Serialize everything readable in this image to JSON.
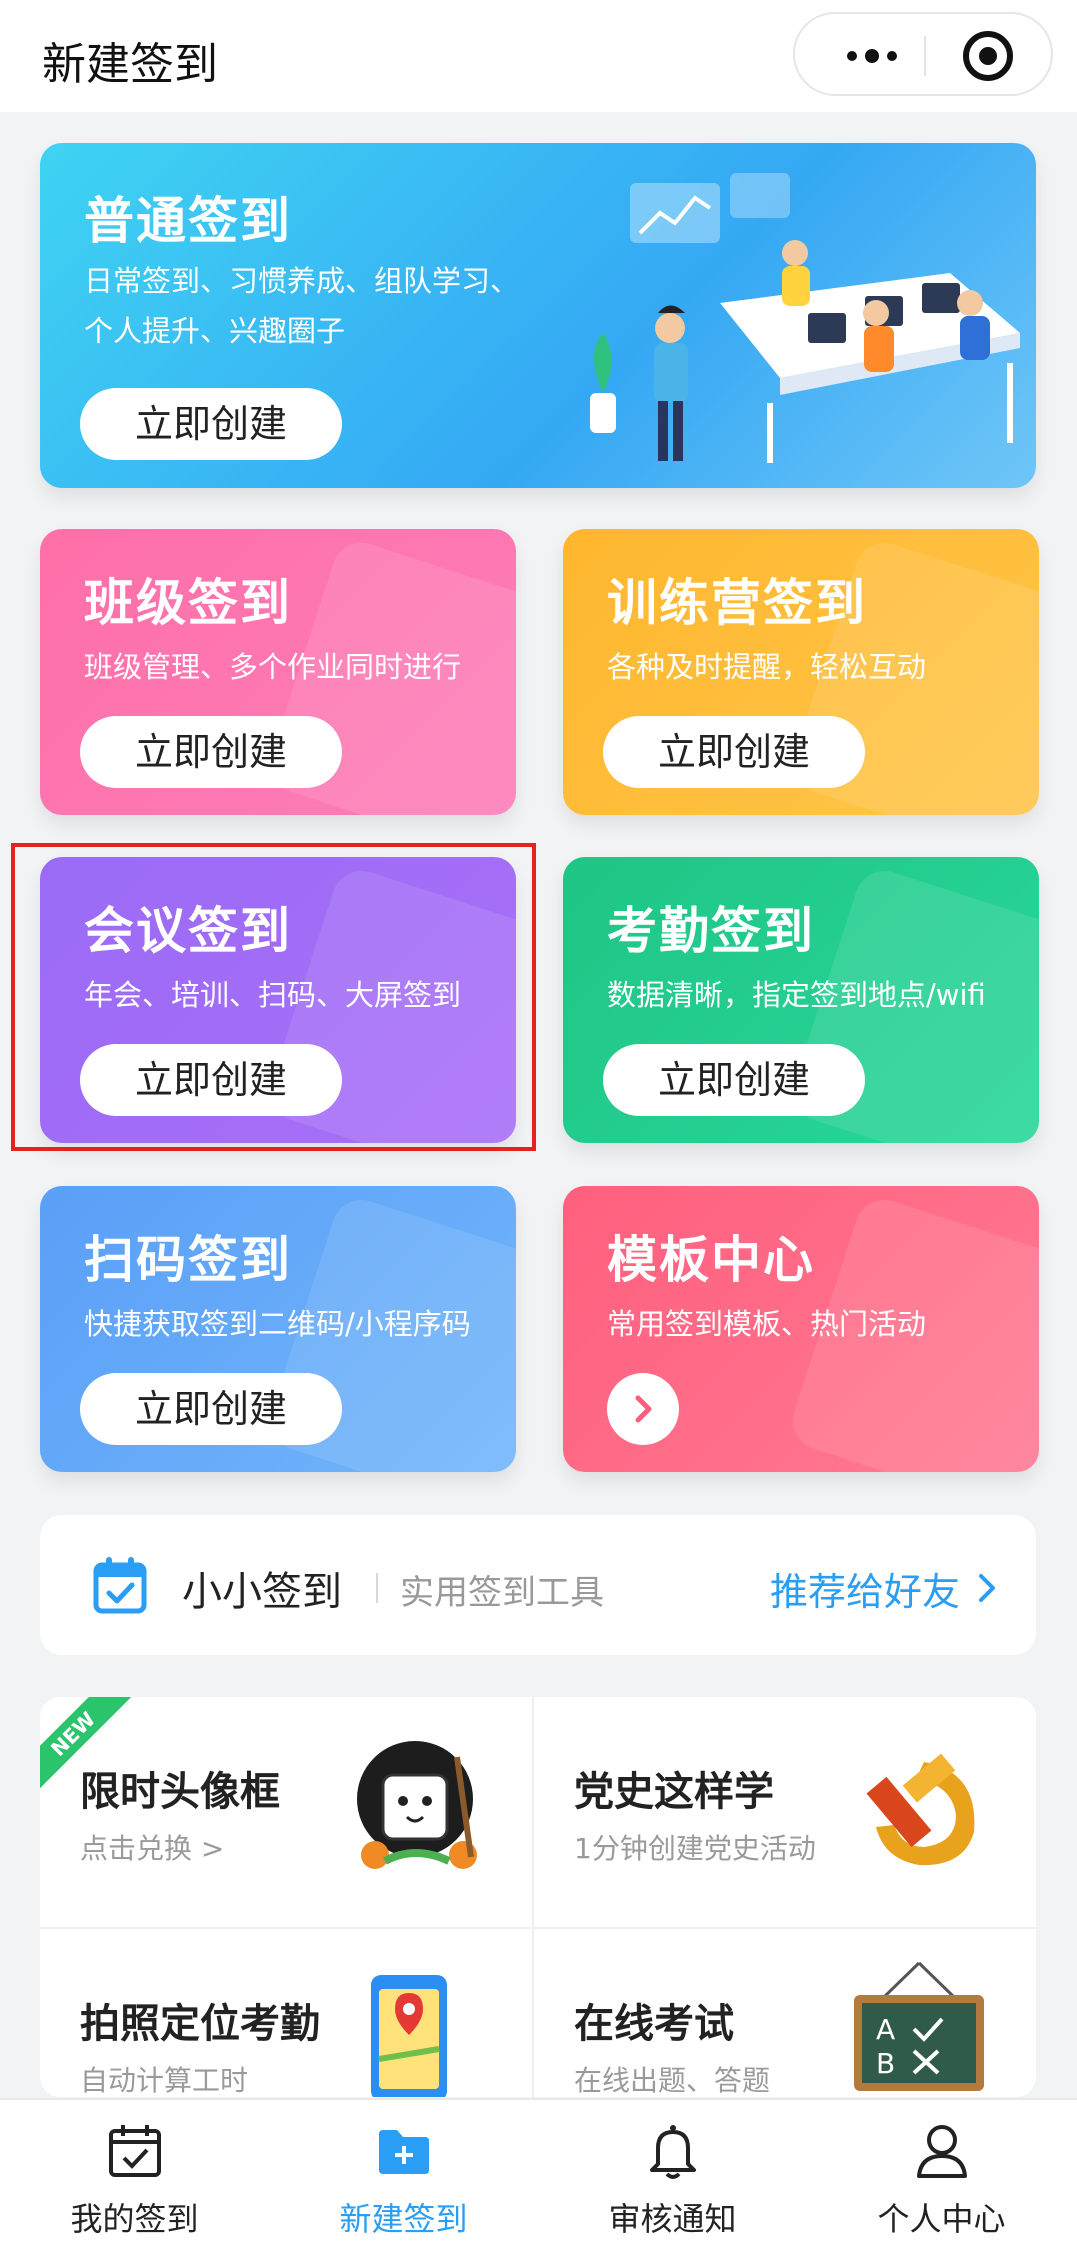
{
  "header": {
    "title": "新建签到"
  },
  "cards": {
    "normal": {
      "title": "普通签到",
      "desc_line1": "日常签到、习惯养成、组队学习、",
      "desc_line2": "个人提升、兴趣圈子",
      "button": "立即创建"
    },
    "class": {
      "title": "班级签到",
      "desc": "班级管理、多个作业同时进行",
      "button": "立即创建"
    },
    "camp": {
      "title": "训练营签到",
      "desc": "各种及时提醒，轻松互动",
      "button": "立即创建"
    },
    "meeting": {
      "title": "会议签到",
      "desc": "年会、培训、扫码、大屏签到",
      "button": "立即创建"
    },
    "attendance": {
      "title": "考勤签到",
      "desc": "数据清晰，指定签到地点/wifi",
      "button": "立即创建"
    },
    "scan": {
      "title": "扫码签到",
      "desc": "快捷获取签到二维码/小程序码",
      "button": "立即创建"
    },
    "template": {
      "title": "模板中心",
      "desc": "常用签到模板、热门活动"
    }
  },
  "brand": {
    "name": "小小签到",
    "slogan": "实用签到工具",
    "share": "推荐给好友"
  },
  "features": [
    {
      "title": "限时头像框",
      "sub": "点击兑换 >",
      "badge": "NEW"
    },
    {
      "title": "党史这样学",
      "sub": "1分钟创建党史活动"
    },
    {
      "title": "拍照定位考勤",
      "sub": "自动计算工时"
    },
    {
      "title": "在线考试",
      "sub": "在线出题、答题"
    }
  ],
  "tabs": [
    {
      "label": "我的签到",
      "icon": "calendar-check-icon"
    },
    {
      "label": "新建签到",
      "icon": "folder-plus-icon",
      "active": true
    },
    {
      "label": "审核通知",
      "icon": "bell-icon"
    },
    {
      "label": "个人中心",
      "icon": "person-icon"
    }
  ],
  "colors": {
    "accent": "#2a9df4",
    "normal": "#35a8f4",
    "class": "#ff6fa8",
    "camp": "#ffb62e",
    "meeting": "#9b6bf6",
    "attendance": "#1fc585",
    "scan": "#5a9ff7",
    "template": "#ff5f7d",
    "highlight": "#e52222"
  }
}
